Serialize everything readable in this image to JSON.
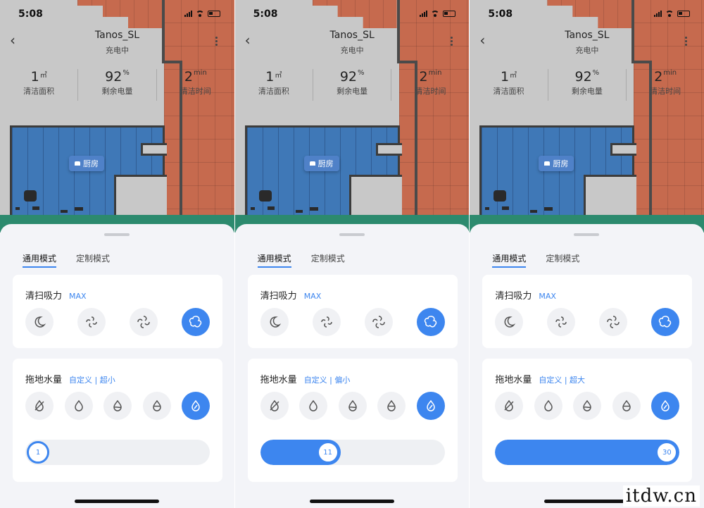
{
  "status_bar": {
    "time": "5:08"
  },
  "header": {
    "title": "Tanos_SL",
    "subtitle": "充电中"
  },
  "stats": [
    {
      "value": "1",
      "unit": "㎡",
      "label": "清洁面积"
    },
    {
      "value": "92",
      "unit": "%",
      "label": "剩余电量"
    },
    {
      "value": "2",
      "unit": "min",
      "label": "清洁时间"
    }
  ],
  "map": {
    "room_label": "厨房"
  },
  "tabs": [
    "通用模式",
    "定制模式"
  ],
  "suction": {
    "label": "清扫吸力",
    "value": "MAX",
    "options": [
      "quiet",
      "standard",
      "strong",
      "max"
    ],
    "selected_index": 3
  },
  "water": {
    "label": "拖地水量",
    "options": [
      "off",
      "low",
      "medium",
      "high",
      "custom"
    ],
    "selected_index": 4
  },
  "screens": [
    {
      "water_value": "自定义 | 超小",
      "slider_value": "1",
      "slider_fraction": 0.0
    },
    {
      "water_value": "自定义 | 偏小",
      "slider_value": "11",
      "slider_fraction": 0.345
    },
    {
      "water_value": "自定义 | 超大",
      "slider_value": "30",
      "slider_fraction": 1.0
    }
  ],
  "colors": {
    "accent": "#3d86ef",
    "map_kitchen": "#3f78b7",
    "map_wood": "#c66a4e",
    "sheet_bg": "#f3f4f8"
  },
  "watermark": "itdw.cn"
}
